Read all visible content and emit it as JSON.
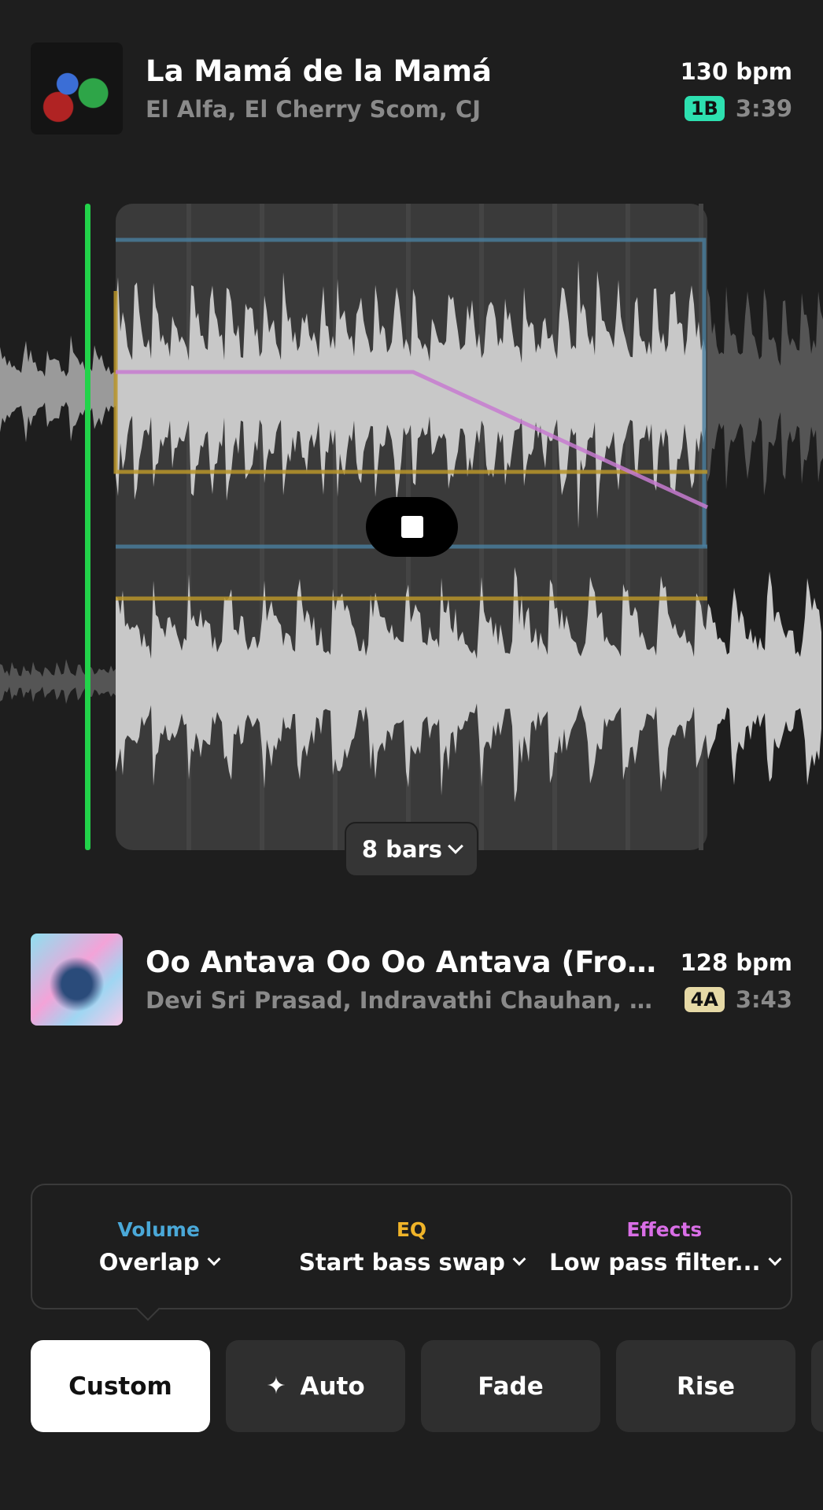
{
  "track_top": {
    "title": "La Mamá de la Mamá",
    "artist": "El Alfa, El Cherry Scom, CJ",
    "bpm": "130 bpm",
    "key": "1B",
    "key_color": "#2de0b0",
    "duration": "3:39"
  },
  "track_bottom": {
    "title": "Oo Antava Oo Oo Antava (From \"P...",
    "artist": "Devi Sri Prasad, Indravathi Chauhan, Chand...",
    "bpm": "128 bpm",
    "key": "4A",
    "key_color": "#e6d9a6",
    "duration": "3:43"
  },
  "transition": {
    "length_label": "8 bars"
  },
  "mix_panel": {
    "volume": {
      "label": "Volume",
      "value": "Overlap",
      "color": "#4aa8d8"
    },
    "eq": {
      "label": "EQ",
      "value": "Start bass swap",
      "color": "#f0b429"
    },
    "effects": {
      "label": "Effects",
      "value": "Low pass filter...",
      "color": "#d96ee6"
    }
  },
  "presets": [
    {
      "label": "Custom",
      "active": true
    },
    {
      "label": "Auto",
      "icon": "sparkle-icon"
    },
    {
      "label": "Fade"
    },
    {
      "label": "Rise"
    }
  ],
  "colors": {
    "playhead": "#22d34a",
    "background": "#1e1e1e"
  }
}
